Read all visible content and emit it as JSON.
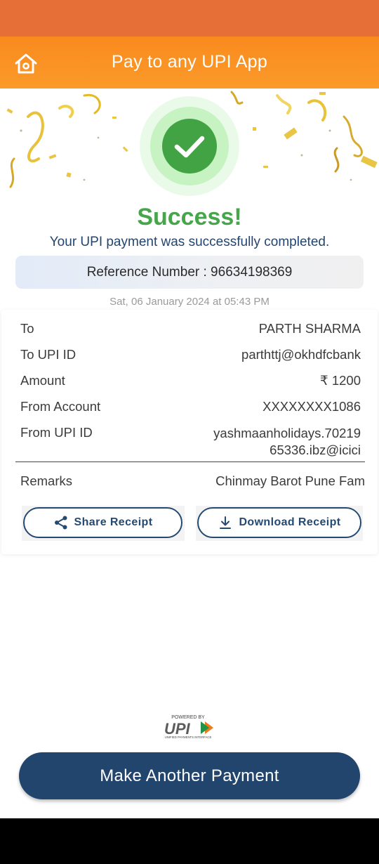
{
  "header": {
    "title": "Pay to any UPI App",
    "home_icon": "home-icon"
  },
  "status": {
    "title": "Success!",
    "subtitle": "Your UPI payment was successfully completed.",
    "reference": "Reference Number : 96634198369",
    "timestamp": "Sat, 06 January 2024 at 05:43 PM"
  },
  "details": [
    {
      "label": "To",
      "value": "PARTH SHARMA"
    },
    {
      "label": "To UPI ID",
      "value": "parthttj@okhdfcbank"
    },
    {
      "label": "Amount",
      "value": "₹ 1200"
    },
    {
      "label": "From Account",
      "value": "XXXXXXXX1086"
    },
    {
      "label": "From UPI ID",
      "value_line1": "yashmaanholidays.70219",
      "value_line2": "65336.ibz@icici"
    },
    {
      "label": "Remarks",
      "value": "Chinmay Barot Pune Fam"
    }
  ],
  "actions": {
    "share_label": "Share Receipt",
    "download_label": "Download Receipt"
  },
  "footer": {
    "powered_by": "POWERED BY",
    "upi_word": "UPI",
    "upi_tagline": "UNIFIED PAYMENTS INTERFACE",
    "cta_label": "Make Another Payment"
  },
  "colors": {
    "header": "#f98a1e",
    "success": "#45a64a",
    "primary": "#22456d"
  }
}
